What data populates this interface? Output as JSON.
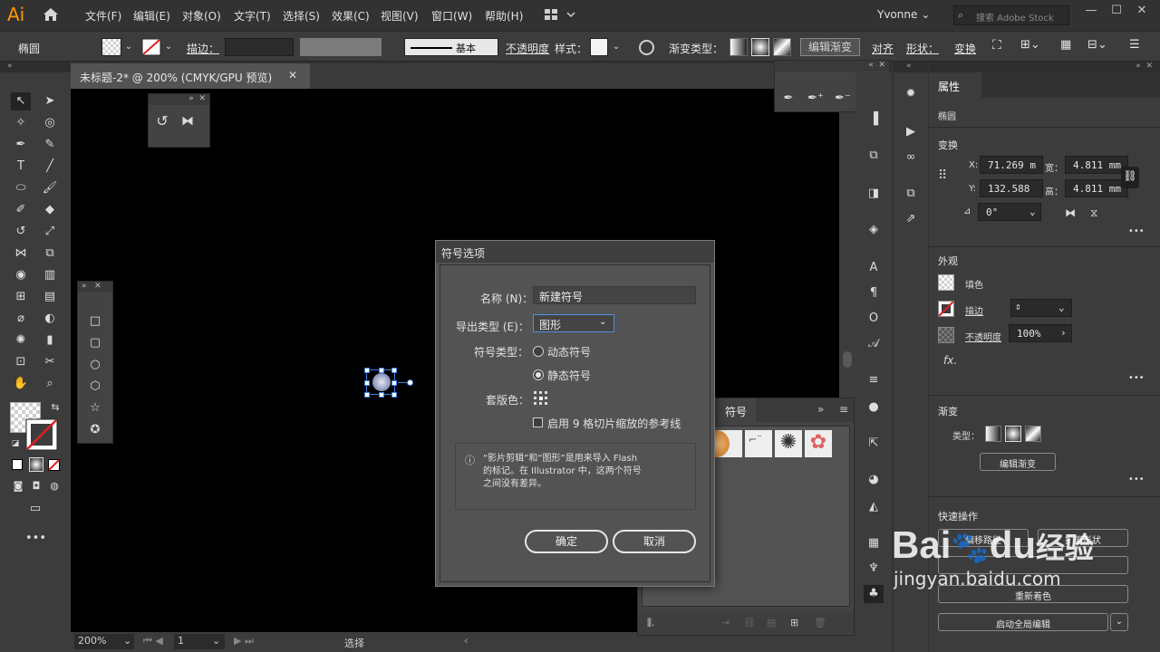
{
  "app": {
    "logo": "Ai",
    "menu": [
      "文件(F)",
      "编辑(E)",
      "对象(O)",
      "文字(T)",
      "选择(S)",
      "效果(C)",
      "视图(V)",
      "窗口(W)",
      "帮助(H)"
    ],
    "user": "Yvonne",
    "search_placeholder": "搜索 Adobe Stock",
    "accent": "#2e7bd6"
  },
  "control_bar": {
    "shape_label": "椭圆",
    "stroke_label": "描边：",
    "stroke_style": "基本",
    "opacity_label": "不透明度",
    "style_label": "样式：",
    "gradient_type_label": "渐变类型：",
    "edit_gradient": "编辑渐变",
    "align": "对齐",
    "shape": "形状：",
    "transform": "变换"
  },
  "document": {
    "tab_title": "未标题-2* @ 200% (CMYK/GPU 预览)",
    "zoom": "200%",
    "page": "1",
    "status_tool": "选择"
  },
  "symbols_panel": {
    "title": "符号"
  },
  "dialog": {
    "title": "符号选项",
    "name_label": "名称 (N)：",
    "name_value": "新建符号",
    "export_type_label": "导出类型 (E)：",
    "export_type_value": "图形",
    "symbol_type_label": "符号类型：",
    "dynamic_symbol": "动态符号",
    "static_symbol": "静态符号",
    "registration_label": "套版色：",
    "nine_slice": "启用 9 格切片缩放的参考线",
    "info_text_1": "“影片剪辑”和“图形”是用来导入 Flash",
    "info_text_2": "的标记。在 Illustrator 中，这两个符号",
    "info_text_3": "之间没有差异。",
    "ok": "确定",
    "cancel": "取消",
    "selected_symbol_type": "static"
  },
  "properties": {
    "tab": "属性",
    "object": "椭圆",
    "transform_title": "变换",
    "x_label": "X:",
    "x_value": "71.269 m",
    "y_label": "Y:",
    "y_value": "132.588",
    "w_label": "宽：",
    "w_value": "4.811 mm",
    "h_label": "高：",
    "h_value": "4.811 mm",
    "angle_value": "0°",
    "appearance_title": "外观",
    "fill": "填色",
    "stroke": "描边",
    "opacity_label": "不透明度",
    "opacity_value": "100%",
    "fx": "fx.",
    "gradient_title": "渐变",
    "type_label": "类型：",
    "edit_gradient": "编辑渐变",
    "quick_actions_title": "快速操作",
    "offset_path": "偏移路径",
    "expand_shape": "扩展形状",
    "recolor": "重新着色",
    "global_edit": "启动全局编辑"
  },
  "watermark": {
    "brand": "Bai",
    "brand2": "du",
    "brand3": "经验",
    "url": "jingyan.baidu.com"
  }
}
